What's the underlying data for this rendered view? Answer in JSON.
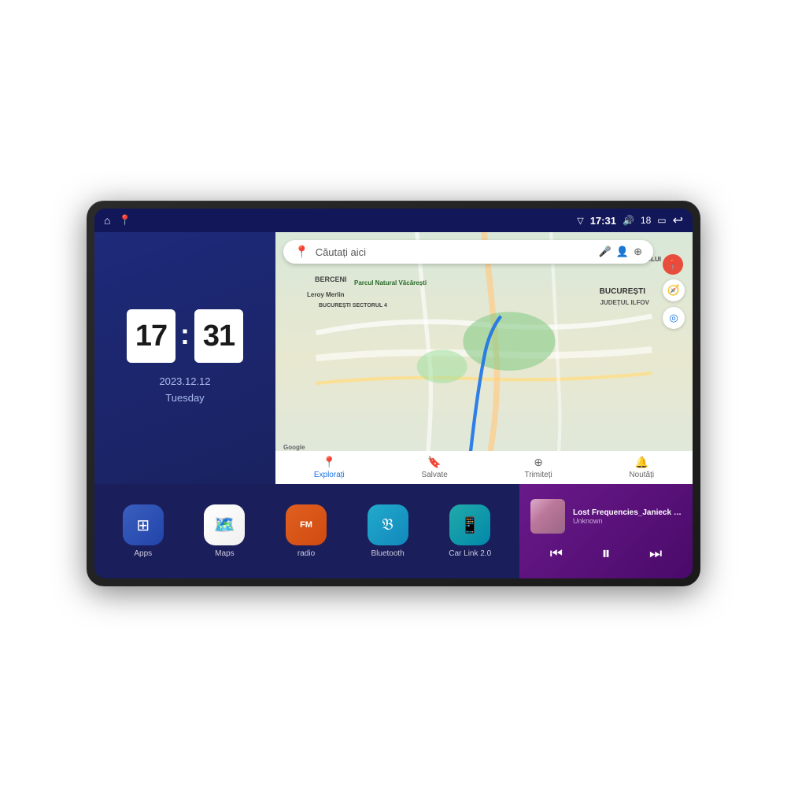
{
  "device": {
    "status_bar": {
      "left_icons": [
        "home",
        "maps"
      ],
      "time": "17:31",
      "signal": "▽",
      "volume": "🔊",
      "battery_level": "18",
      "battery_icon": "🔋",
      "back": "↩"
    },
    "clock": {
      "hour": "17",
      "minute": "31",
      "date": "2023.12.12",
      "weekday": "Tuesday"
    },
    "map": {
      "search_placeholder": "Căutați aici",
      "labels": {
        "bucur": "BUCUREȘTI",
        "ilfov": "JUDEȚUL ILFOV",
        "trapez": "TRAPEZULUI",
        "berceni": "BERCENI",
        "parcul": "Parcul Natural Văcărești",
        "leroy": "Leroy Merlin",
        "sector4": "BUCUREȘTI SECTORUL 4",
        "google": "Google"
      },
      "nav_items": [
        {
          "label": "Explorați",
          "icon": "📍",
          "active": true
        },
        {
          "label": "Salvate",
          "icon": "🔖",
          "active": false
        },
        {
          "label": "Trimiteți",
          "icon": "⊕",
          "active": false
        },
        {
          "label": "Noutăți",
          "icon": "🔔",
          "active": false
        }
      ]
    },
    "apps": [
      {
        "label": "Apps",
        "icon": "⊞",
        "style": "blue-grad"
      },
      {
        "label": "Maps",
        "icon": "📍",
        "style": "green-grad"
      },
      {
        "label": "radio",
        "icon": "📻",
        "style": "orange-grad"
      },
      {
        "label": "Bluetooth",
        "icon": "🔵",
        "style": "cyan-grad"
      },
      {
        "label": "Car Link 2.0",
        "icon": "📱",
        "style": "teal-grad"
      }
    ],
    "music": {
      "title": "Lost Frequencies_Janieck Devy-...",
      "artist": "Unknown",
      "controls": {
        "prev": "⏮",
        "play": "⏸",
        "next": "⏭"
      }
    }
  }
}
